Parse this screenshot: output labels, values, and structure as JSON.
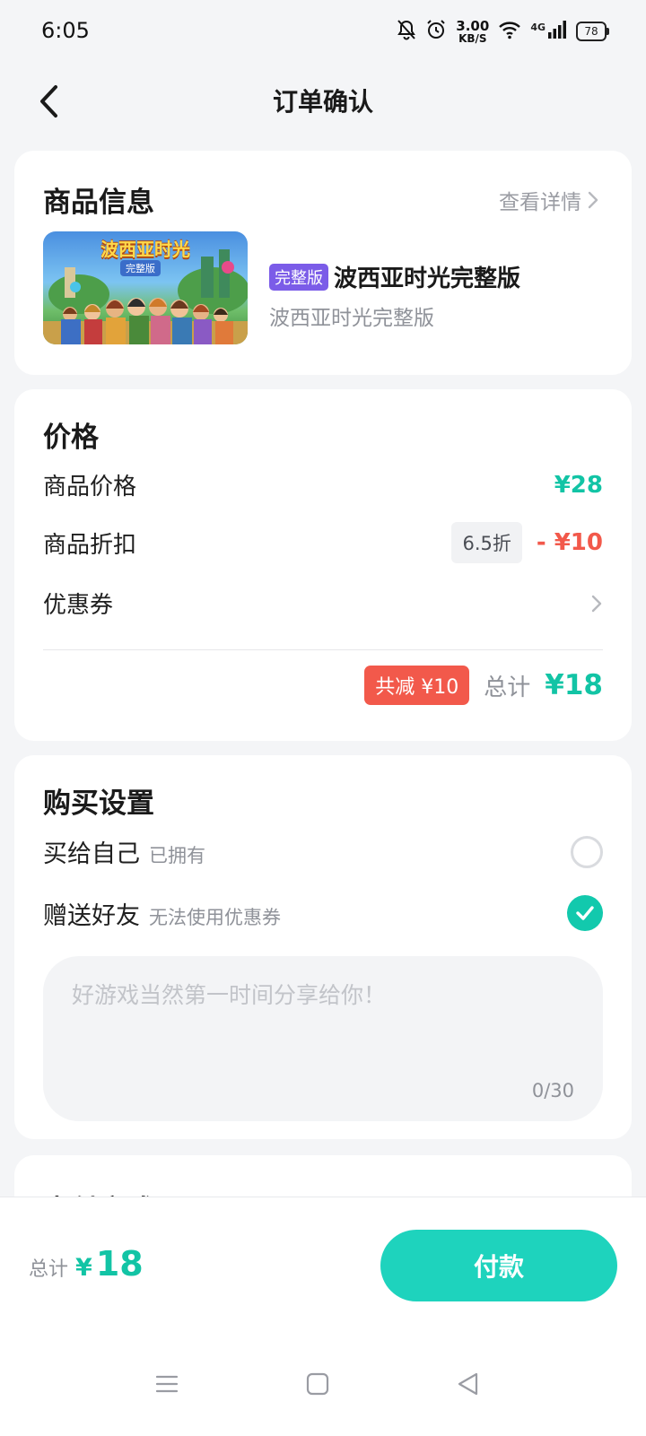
{
  "status_bar": {
    "time": "6:05",
    "net_speed_value": "3.00",
    "net_speed_unit": "KB/S",
    "network_type": "4G",
    "battery": "78"
  },
  "header": {
    "title": "订单确认"
  },
  "product": {
    "section_title": "商品信息",
    "detail_link": "查看详情",
    "thumbnail_title": "波西亚时光",
    "thumbnail_badge": "完整版",
    "edition_tag": "完整版",
    "name": "波西亚时光完整版",
    "subtitle": "波西亚时光完整版"
  },
  "price": {
    "section_title": "价格",
    "item_price_label": "商品价格",
    "item_price_value": "¥28",
    "discount_label": "商品折扣",
    "discount_rate": "6.5折",
    "discount_value": "- ¥10",
    "coupon_label": "优惠券",
    "saved_badge": "共减 ¥10",
    "total_label": "总计",
    "total_value": "¥18"
  },
  "purchase_settings": {
    "section_title": "购买设置",
    "self_label": "买给自己",
    "self_note": "已拥有",
    "gift_label": "赠送好友",
    "gift_note": "无法使用优惠券",
    "message_placeholder": "好游戏当然第一时间分享给你！",
    "message_count": "0/30"
  },
  "payment": {
    "section_title": "支付方式"
  },
  "bottom_bar": {
    "total_label": "总计",
    "currency": "¥",
    "total_amount": "18",
    "pay_button": "付款"
  },
  "colors": {
    "accent": "#12c4a5",
    "danger": "#f2594b",
    "edition_tag": "#7b5ce8"
  }
}
